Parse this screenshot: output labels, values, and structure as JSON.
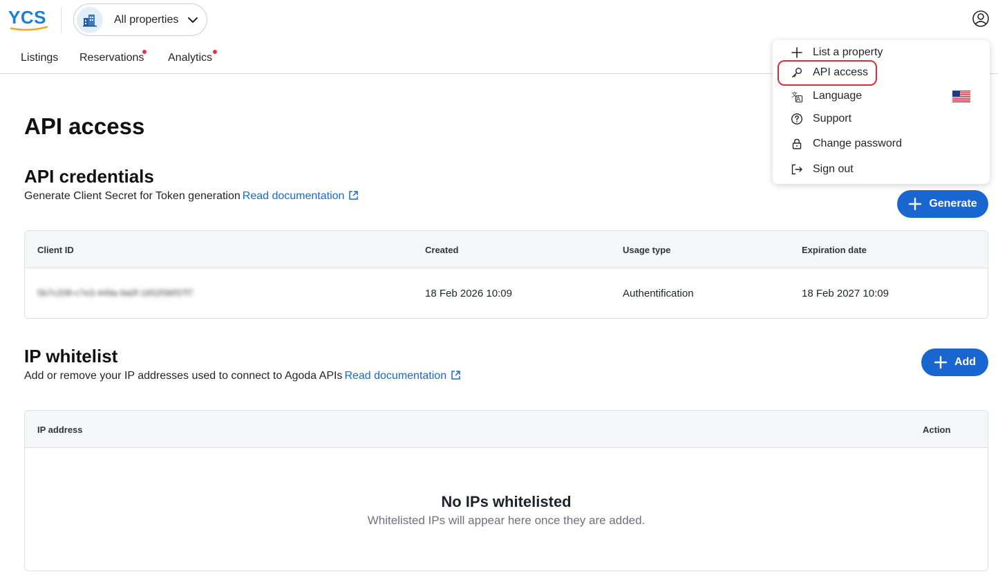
{
  "header": {
    "logo_text": "YCS",
    "property_selector": "All properties"
  },
  "nav": {
    "items": [
      {
        "label": "Listings",
        "has_dot": false
      },
      {
        "label": "Reservations",
        "has_dot": true
      },
      {
        "label": "Analytics",
        "has_dot": true
      }
    ]
  },
  "page": {
    "title": "API access"
  },
  "credentials": {
    "title": "API credentials",
    "subtitle": "Generate Client Secret for Token generation",
    "doc_link": "Read documentation",
    "generate_label": "Generate",
    "columns": [
      "Client ID",
      "Created",
      "Usage type",
      "Expiration date"
    ],
    "rows": [
      {
        "client_id": "5b7c208-c7e3-449a-9a0f-1652f36f37f7",
        "created": "18 Feb 2026 10:09",
        "usage_type": "Authentification",
        "expiration": "18 Feb 2027 10:09"
      }
    ]
  },
  "whitelist": {
    "title": "IP whitelist",
    "subtitle": "Add or remove your IP addresses used to connect to Agoda APIs",
    "doc_link": "Read documentation",
    "add_label": "Add",
    "columns": [
      "IP address",
      "Action"
    ],
    "empty_title": "No IPs whitelisted",
    "empty_subtitle": "Whitelisted IPs will appear here once they are added."
  },
  "user_menu": {
    "items": [
      {
        "label": "List a property",
        "icon": "plus-icon"
      },
      {
        "label": "API access",
        "icon": "key-icon"
      },
      {
        "label": "Language",
        "icon": "translate-icon",
        "flag": "us-flag-icon"
      },
      {
        "label": "Support",
        "icon": "question-circle-icon"
      },
      {
        "label": "Change password",
        "icon": "lock-icon"
      },
      {
        "label": "Sign out",
        "icon": "sign-out-icon"
      }
    ],
    "highlighted": "API access"
  },
  "colors": {
    "primary": "#1a66d1",
    "link": "#1a66d1",
    "notification_dot": "#e0344e",
    "highlight_ring": "#e0283c"
  }
}
